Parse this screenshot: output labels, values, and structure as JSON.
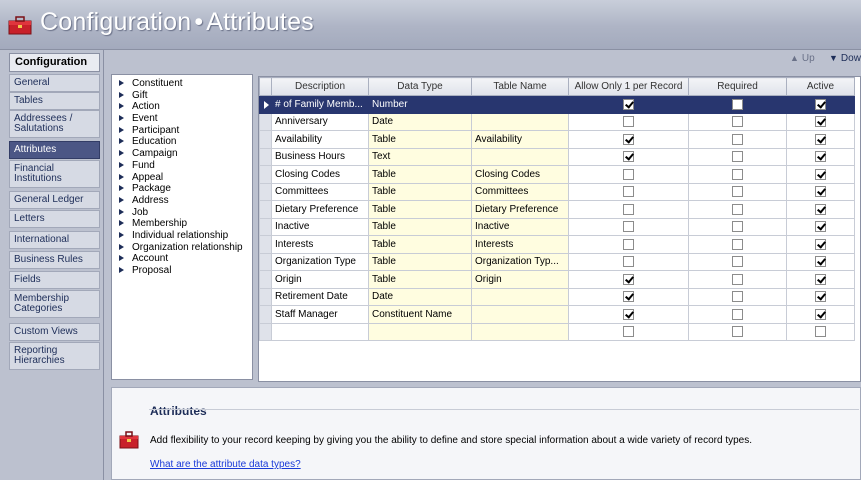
{
  "window": {
    "title_main": "Configuration",
    "title_separator": "•",
    "title_section": "Attributes"
  },
  "nav": {
    "header": "Configuration",
    "items": [
      {
        "label": "General"
      },
      {
        "label": "Tables"
      },
      {
        "label": "Addressees / Salutations"
      },
      {
        "label": "Attributes",
        "active": true
      },
      {
        "label": "Financial Institutions"
      },
      {
        "label": "General Ledger"
      },
      {
        "label": "Letters"
      },
      {
        "label": "International"
      },
      {
        "label": "Business Rules"
      },
      {
        "label": "Fields"
      },
      {
        "label": "Membership Categories"
      },
      {
        "label": "Custom Views"
      },
      {
        "label": "Reporting Hierarchies"
      }
    ]
  },
  "toolbar": {
    "up_label": "Up",
    "down_label": "Dow"
  },
  "tree": {
    "items": [
      "Constituent",
      "Gift",
      "Action",
      "Event",
      "Participant",
      "Education",
      "Campaign",
      "Fund",
      "Appeal",
      "Package",
      "Address",
      "Job",
      "Membership",
      "Individual relationship",
      "Organization relationship",
      "Account",
      "Proposal"
    ]
  },
  "grid": {
    "columns": [
      "Description",
      "Data Type",
      "Table Name",
      "Allow Only 1 per Record",
      "Required",
      "Active"
    ],
    "rows": [
      {
        "description": "# of Family Memb...",
        "data_type": "Number",
        "table_name": "",
        "allow_one": true,
        "required": false,
        "active": true,
        "selected": true
      },
      {
        "description": "Anniversary",
        "data_type": "Date",
        "table_name": "",
        "allow_one": false,
        "required": false,
        "active": true
      },
      {
        "description": "Availability",
        "data_type": "Table",
        "table_name": "Availability",
        "allow_one": true,
        "required": false,
        "active": true
      },
      {
        "description": "Business Hours",
        "data_type": "Text",
        "table_name": "",
        "allow_one": true,
        "required": false,
        "active": true
      },
      {
        "description": "Closing Codes",
        "data_type": "Table",
        "table_name": "Closing Codes",
        "allow_one": false,
        "required": false,
        "active": true
      },
      {
        "description": "Committees",
        "data_type": "Table",
        "table_name": "Committees",
        "allow_one": false,
        "required": false,
        "active": true
      },
      {
        "description": "Dietary Preference",
        "data_type": "Table",
        "table_name": "Dietary Preference",
        "allow_one": false,
        "required": false,
        "active": true
      },
      {
        "description": "Inactive",
        "data_type": "Table",
        "table_name": "Inactive",
        "allow_one": false,
        "required": false,
        "active": true
      },
      {
        "description": "Interests",
        "data_type": "Table",
        "table_name": "Interests",
        "allow_one": false,
        "required": false,
        "active": true
      },
      {
        "description": "Organization Type",
        "data_type": "Table",
        "table_name": "Organization Typ...",
        "allow_one": false,
        "required": false,
        "active": true
      },
      {
        "description": "Origin",
        "data_type": "Table",
        "table_name": "Origin",
        "allow_one": true,
        "required": false,
        "active": true
      },
      {
        "description": "Retirement Date",
        "data_type": "Date",
        "table_name": "",
        "allow_one": true,
        "required": false,
        "active": true
      },
      {
        "description": "Staff Manager",
        "data_type": "Constituent Name",
        "table_name": "",
        "allow_one": true,
        "required": false,
        "active": true
      },
      {
        "description": "",
        "data_type": "",
        "table_name": "",
        "allow_one": false,
        "required": false,
        "active": false
      }
    ]
  },
  "help": {
    "title": "Attributes",
    "text": "Add flexibility to your record keeping by giving you the ability to define and store special information about a wide variety of record types.",
    "link": "What are the attribute data types?"
  },
  "colors": {
    "selected_row": "#28366f",
    "highlight_cell": "#fffde0",
    "nav_active": "#4b5685",
    "link": "#1a3ad8"
  }
}
